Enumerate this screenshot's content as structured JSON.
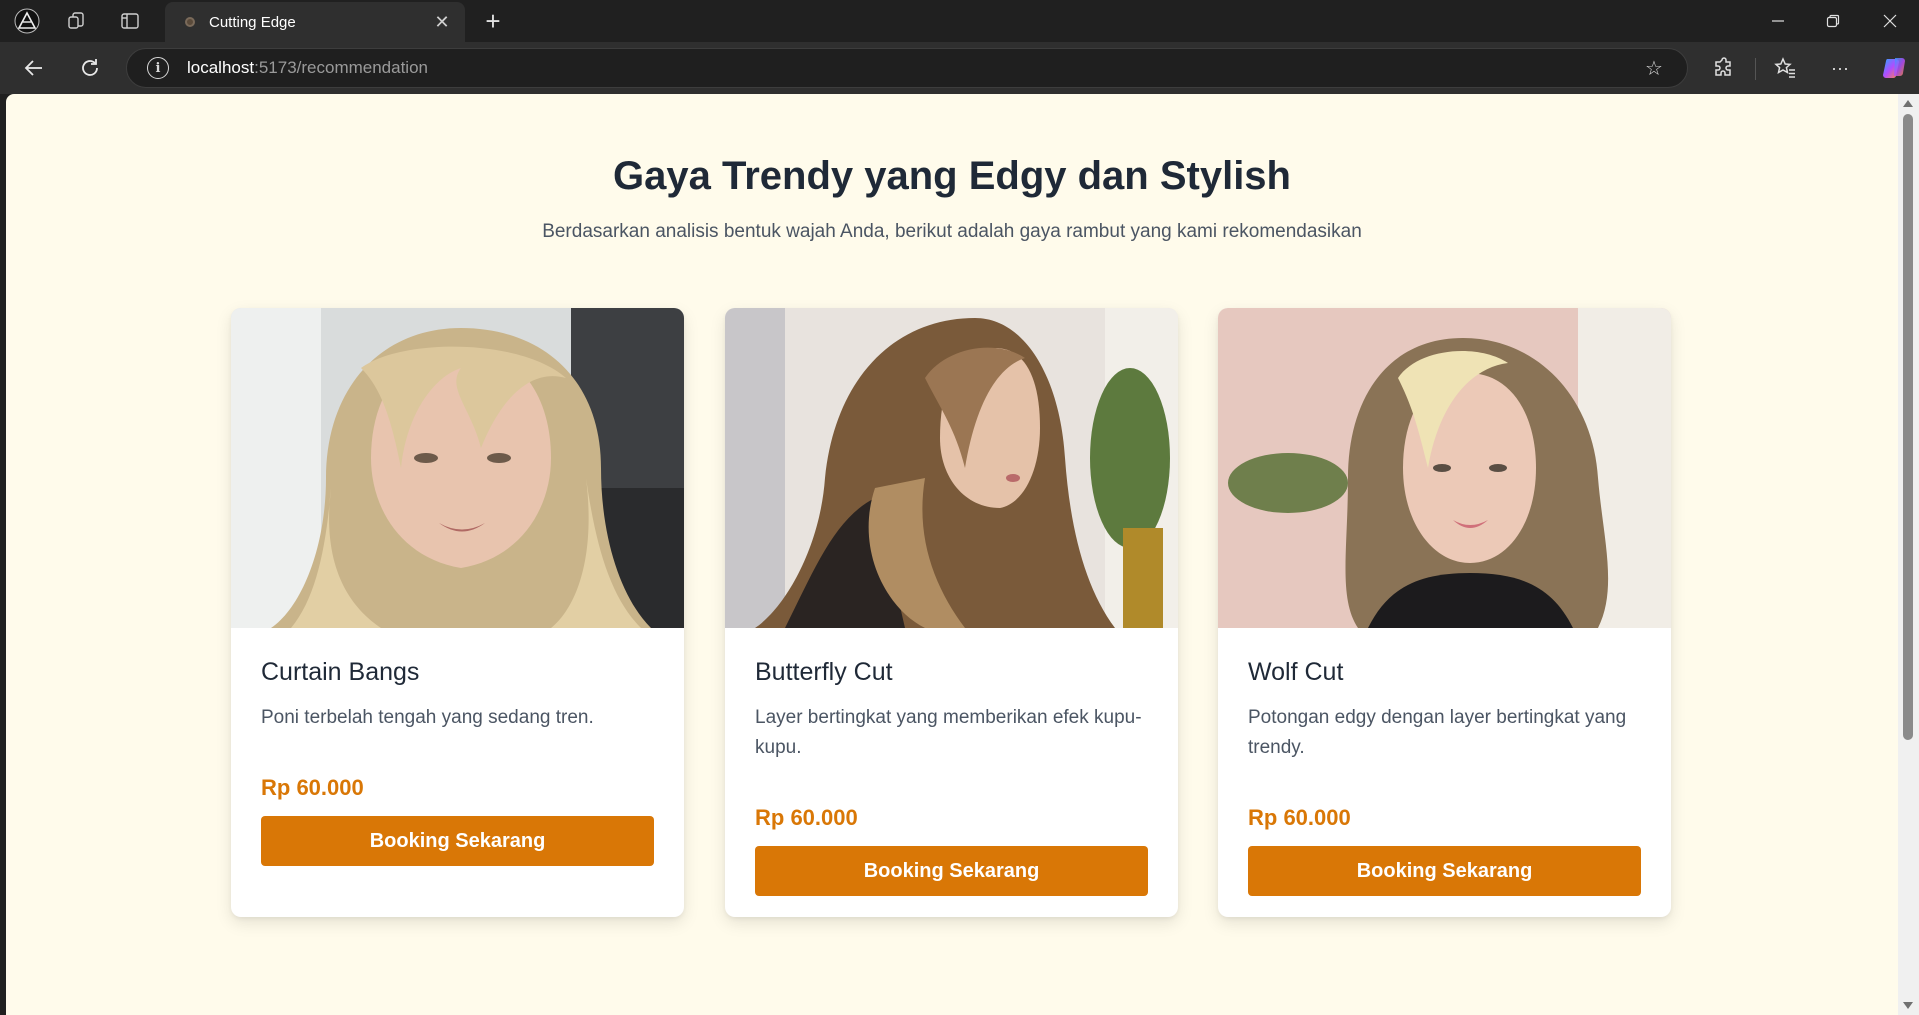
{
  "browser": {
    "tab_title": "Cutting Edge",
    "url_host": "localhost",
    "url_path": ":5173/recommendation"
  },
  "page": {
    "heading": "Gaya Trendy yang Edgy dan Stylish",
    "subheading": "Berdasarkan analisis bentuk wajah Anda, berikut adalah gaya rambut yang kami rekomendasikan"
  },
  "cards": [
    {
      "name": "Curtain Bangs",
      "description": "Poni terbelah tengah yang sedang tren.",
      "price": "Rp 60.000",
      "button": "Booking Sekarang"
    },
    {
      "name": "Butterfly Cut",
      "description": "Layer bertingkat yang memberikan efek kupu-kupu.",
      "price": "Rp 60.000",
      "button": "Booking Sekarang"
    },
    {
      "name": "Wolf Cut",
      "description": "Potongan edgy dengan layer bertingkat yang trendy.",
      "price": "Rp 60.000",
      "button": "Booking Sekarang"
    }
  ],
  "colors": {
    "accent": "#d97706",
    "page_bg": "#fffbeb",
    "heading": "#1f2937",
    "body_text": "#4b5563"
  },
  "icons": [
    "app-logo-icon",
    "workspaces-icon",
    "tab-actions-icon",
    "close-icon",
    "plus-icon",
    "minimize-icon",
    "restore-icon",
    "back-icon",
    "refresh-icon",
    "info-icon",
    "star-icon",
    "extensions-icon",
    "favorites-icon",
    "more-icon",
    "copilot-icon"
  ]
}
